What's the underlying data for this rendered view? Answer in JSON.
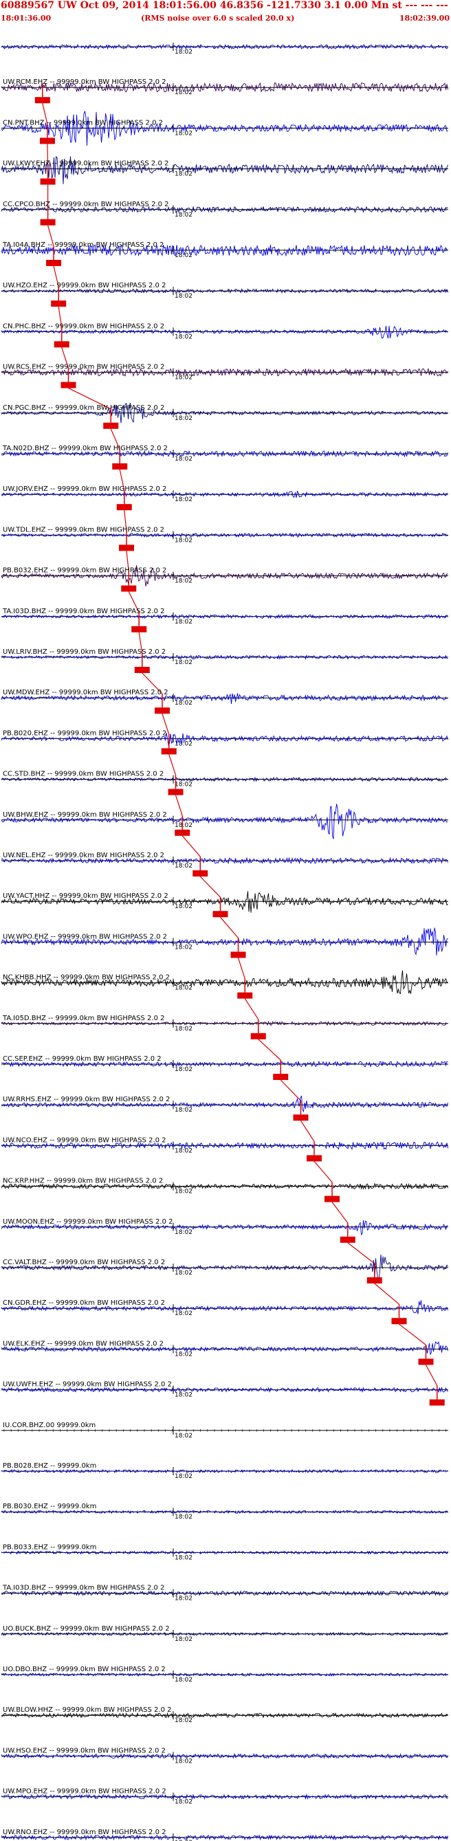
{
  "header": {
    "title": "60889567 UW Oct 09, 2014 18:01:56.00   46.8356  -121.7330  3.1 0.00  Mn st --- --- ---  -1",
    "start_time": "18:01:36.00",
    "scaling_note": "(RMS noise over 6.0 s scaled 20.0 x)",
    "end_time": "18:02:39.00"
  },
  "chart_data": {
    "type": "line",
    "title": "60889567 UW Oct 09, 2014 18:01:56.00   46.8356  -121.7330  3.1 0.00  Mn st --- --- ---  -1",
    "x_range": [
      "18:01:36.00",
      "18:02:39.00"
    ],
    "tick_label": "18:02",
    "colors": {
      "header": "#d40000",
      "pick": "#e00000",
      "trace_blue": "#0000e0",
      "trace_navy": "#000080",
      "trace_purple": "#330055",
      "trace_black": "#000000",
      "axis": "#000000"
    },
    "traces": [
      {
        "label": "",
        "tick": "18:02",
        "color": "#0000e0",
        "amp": 3,
        "burst": null,
        "pick": null
      },
      {
        "label": "UW.RCM.EHZ -- 99999.0km BW HIGHPASS  2.0  2",
        "tick": "18:02",
        "color": "#330055",
        "amp": 5,
        "burst": null,
        "pick": 0.092
      },
      {
        "label": "CN.PNT.BHZ -- 99999.0km BW HIGHPASS  2.0  2",
        "tick": "18:02",
        "color": "#0000e0",
        "amp": 4,
        "burst": {
          "center": 0.2,
          "width": 0.12,
          "amp": 22
        },
        "pick": 0.103
      },
      {
        "label": "UW.LKWY.EHZ -- 99999.0km BW HIGHPASS  2.0  2",
        "tick": "18:02",
        "color": "#000080",
        "amp": 5,
        "burst": {
          "center": 0.135,
          "width": 0.05,
          "amp": 16
        },
        "pick": 0.104
      },
      {
        "label": "CC.CPCO.BHZ -- 99999.0km BW HIGHPASS  2.0  2",
        "tick": "18:02",
        "color": "#000080",
        "amp": 3,
        "burst": null,
        "pick": 0.104
      },
      {
        "label": "TA.I04A.BHZ -- 99999.0km BW HIGHPASS  2.0  2",
        "tick": "18:02",
        "color": "#0000e0",
        "amp": 6,
        "burst": null,
        "pick": 0.117
      },
      {
        "label": "UW.HZO.EHZ -- 99999.0km BW HIGHPASS  2.0  2",
        "tick": "18:02",
        "color": "#000080",
        "amp": 2,
        "burst": null,
        "pick": 0.128
      },
      {
        "label": "CN.PHC.BHZ -- 99999.0km BW HIGHPASS  2.0  2",
        "tick": "18:02",
        "color": "#0000e0",
        "amp": 2,
        "burst": {
          "center": 0.86,
          "width": 0.05,
          "amp": 8
        },
        "pick": 0.135
      },
      {
        "label": "UW.RCS.EHZ -- 99999.0km BW HIGHPASS  2.0  2",
        "tick": "18:02",
        "color": "#330055",
        "amp": 4,
        "burst": null,
        "pick": 0.15
      },
      {
        "label": "CN.PGC.BHZ -- 99999.0km BW HIGHPASS  2.0  2",
        "tick": "18:02",
        "color": "#000080",
        "amp": 2,
        "burst": {
          "center": 0.28,
          "width": 0.06,
          "amp": 14
        },
        "pick": 0.245
      },
      {
        "label": "TA.N02D.BHZ -- 99999.0km BW HIGHPASS  2.0  2",
        "tick": "18:02",
        "color": "#0000e0",
        "amp": 3,
        "burst": null,
        "pick": 0.265
      },
      {
        "label": "UW.JORV.EHZ -- 99999.0km BW HIGHPASS  2.0  2",
        "tick": "18:02",
        "color": "#0000e0",
        "amp": 2,
        "burst": {
          "center": 0.66,
          "width": 0.02,
          "amp": 6
        },
        "pick": 0.275
      },
      {
        "label": "UW.TDL.EHZ -- 99999.0km BW HIGHPASS  2.0  2",
        "tick": "18:02",
        "color": "#0000e0",
        "amp": 2,
        "burst": null,
        "pick": 0.28
      },
      {
        "label": "PB.B032.EHZ -- 99999.0km BW HIGHPASS  2.0  2",
        "tick": "18:02",
        "color": "#330055",
        "amp": 3,
        "burst": {
          "center": 0.31,
          "width": 0.05,
          "amp": 14
        },
        "pick": 0.285
      },
      {
        "label": "TA.I03D.BHZ -- 99999.0km BW HIGHPASS  2.0  2",
        "tick": "18:02",
        "color": "#0000e0",
        "amp": 2,
        "burst": null,
        "pick": 0.308
      },
      {
        "label": "UW.LRIV.BHZ -- 99999.0km BW HIGHPASS  2.0  2",
        "tick": "18:02",
        "color": "#0000e0",
        "amp": 2,
        "burst": null,
        "pick": 0.315
      },
      {
        "label": "UW.MDW.EHZ -- 99999.0km BW HIGHPASS  2.0  2",
        "tick": "18:02",
        "color": "#0000e0",
        "amp": 3,
        "burst": {
          "center": 0.52,
          "width": 0.02,
          "amp": 6
        },
        "pick": 0.36
      },
      {
        "label": "PB.B020.EHZ -- 99999.0km BW HIGHPASS  2.0  2",
        "tick": "18:02",
        "color": "#0000e0",
        "amp": 3,
        "burst": {
          "center": 0.385,
          "width": 0.03,
          "amp": 10
        },
        "pick": 0.375
      },
      {
        "label": "CC.STD.BHZ -- 99999.0km BW HIGHPASS  2.0  2",
        "tick": "18:02",
        "color": "#000080",
        "amp": 2,
        "burst": null,
        "pick": 0.39
      },
      {
        "label": "UW.BHW.EHZ -- 99999.0km BW HIGHPASS  2.0  2",
        "tick": "18:02",
        "color": "#0000e0",
        "amp": 3,
        "burst": {
          "center": 0.75,
          "width": 0.05,
          "amp": 26
        },
        "pick": 0.405
      },
      {
        "label": "UW.NEL.EHZ -- 99999.0km BW HIGHPASS  2.0  2",
        "tick": "18:02",
        "color": "#0000e0",
        "amp": 3,
        "burst": null,
        "pick": 0.445
      },
      {
        "label": "UW.YACT.HHZ -- 99999.0km BW HIGHPASS  2.0  2",
        "tick": "18:02",
        "color": "#000000",
        "amp": 4,
        "burst": {
          "center": 0.57,
          "width": 0.05,
          "amp": 16
        },
        "pick": 0.49
      },
      {
        "label": "UW.WPO.EHZ -- 99999.0km BW HIGHPASS  2.0  2",
        "tick": "18:02",
        "color": "#0000e0",
        "amp": 4,
        "burst": {
          "center": 0.95,
          "width": 0.05,
          "amp": 24
        },
        "pick": 0.53
      },
      {
        "label": "NC.KHBB.HHZ -- 99999.0km BW HIGHPASS  2.0  2",
        "tick": "18:02",
        "color": "#000000",
        "amp": 5,
        "burst": {
          "center": 0.9,
          "width": 0.05,
          "amp": 12
        },
        "pick": 0.545
      },
      {
        "label": "TA.I05D.BHZ -- 99999.0km BW HIGHPASS  2.0  2",
        "tick": "18:02",
        "color": "#330055",
        "amp": 2,
        "burst": null,
        "pick": 0.575
      },
      {
        "label": "CC.SEP.EHZ -- 99999.0km BW HIGHPASS  2.0  2",
        "tick": "18:02",
        "color": "#0000e0",
        "amp": 3,
        "burst": null,
        "pick": 0.625
      },
      {
        "label": "UW.RRHS.EHZ -- 99999.0km BW HIGHPASS  2.0  2",
        "tick": "18:02",
        "color": "#0000e0",
        "amp": 3,
        "burst": {
          "center": 0.67,
          "width": 0.02,
          "amp": 10
        },
        "pick": 0.67
      },
      {
        "label": "UW.NCO.EHZ -- 99999.0km BW HIGHPASS  2.0  2",
        "tick": "18:02",
        "color": "#0000e0",
        "amp": 4,
        "burst": null,
        "pick": 0.7
      },
      {
        "label": "NC.KRP.HHZ -- 99999.0km BW HIGHPASS  2.0  2",
        "tick": "18:02",
        "color": "#000000",
        "amp": 3,
        "burst": null,
        "pick": 0.74
      },
      {
        "label": "UW.MOON.EHZ -- 99999.0km BW HIGHPASS  2.0  2",
        "tick": "18:02",
        "color": "#0000e0",
        "amp": 3,
        "burst": {
          "center": 0.8,
          "width": 0.03,
          "amp": 8
        },
        "pick": 0.775
      },
      {
        "label": "CC.VALT.BHZ -- 99999.0km BW HIGHPASS  2.0  2",
        "tick": "18:02",
        "color": "#000080",
        "amp": 3,
        "burst": {
          "center": 0.85,
          "width": 0.03,
          "amp": 16
        },
        "pick": 0.835
      },
      {
        "label": "CN.GDR.EHZ -- 99999.0km BW HIGHPASS  2.0  2",
        "tick": "18:02",
        "color": "#0000e0",
        "amp": 3,
        "burst": {
          "center": 0.94,
          "width": 0.02,
          "amp": 10
        },
        "pick": 0.89
      },
      {
        "label": "UW.ELK.EHZ -- 99999.0km BW HIGHPASS  2.0  2",
        "tick": "18:02",
        "color": "#0000e0",
        "amp": 3,
        "burst": {
          "center": 0.97,
          "width": 0.02,
          "amp": 12
        },
        "pick": 0.95
      },
      {
        "label": "UW.UWFH.EHZ -- 99999.0km BW HIGHPASS  2.0  2",
        "tick": "18:02",
        "color": "#0000e0",
        "amp": 3,
        "burst": null,
        "pick": 0.975
      },
      {
        "label": "IU.COR.BHZ.00 99999.0km",
        "tick": "18:02",
        "color": "#0000e0",
        "amp": 0,
        "burst": null,
        "pick": null
      },
      {
        "label": "PB.B028.EHZ -- 99999.0km",
        "tick": "18:02",
        "color": "#0000e0",
        "amp": 2,
        "burst": null,
        "pick": null
      },
      {
        "label": "PB.B030.EHZ -- 99999.0km",
        "tick": "18:02",
        "color": "#0000e0",
        "amp": 2,
        "burst": null,
        "pick": null
      },
      {
        "label": "PB.B033.EHZ -- 99999.0km",
        "tick": "18:02",
        "color": "#0000e0",
        "amp": 2,
        "burst": null,
        "pick": null
      },
      {
        "label": "TA.I03D.BHZ -- 99999.0km BW HIGHPASS  2.0  2",
        "tick": "18:02",
        "color": "#000080",
        "amp": 3,
        "burst": null,
        "pick": null
      },
      {
        "label": "UO.BUCK.BHZ -- 99999.0km BW HIGHPASS  2.0  2",
        "tick": "18:02",
        "color": "#000080",
        "amp": 2,
        "burst": null,
        "pick": null
      },
      {
        "label": "UO.DBO.BHZ -- 99999.0km BW HIGHPASS  2.0  2",
        "tick": "18:02",
        "color": "#0000e0",
        "amp": 2,
        "burst": null,
        "pick": null
      },
      {
        "label": "UW.BLOW.HHZ -- 99999.0km BW HIGHPASS  2.0  2",
        "tick": "18:02",
        "color": "#000000",
        "amp": 3,
        "burst": null,
        "pick": null
      },
      {
        "label": "UW.HSO.EHZ -- 99999.0km BW HIGHPASS  2.0  2",
        "tick": "18:02",
        "color": "#0000e0",
        "amp": 3,
        "burst": null,
        "pick": null
      },
      {
        "label": "UW.MPO.EHZ -- 99999.0km BW HIGHPASS  2.0  2",
        "tick": "18:02",
        "color": "#0000e0",
        "amp": 3,
        "burst": null,
        "pick": null
      },
      {
        "label": "UW.RNO.EHZ -- 99999.0km BW HIGHPASS  2.0  2",
        "tick": "18:02",
        "color": "#0000e0",
        "amp": 3,
        "burst": null,
        "pick": null
      }
    ]
  }
}
